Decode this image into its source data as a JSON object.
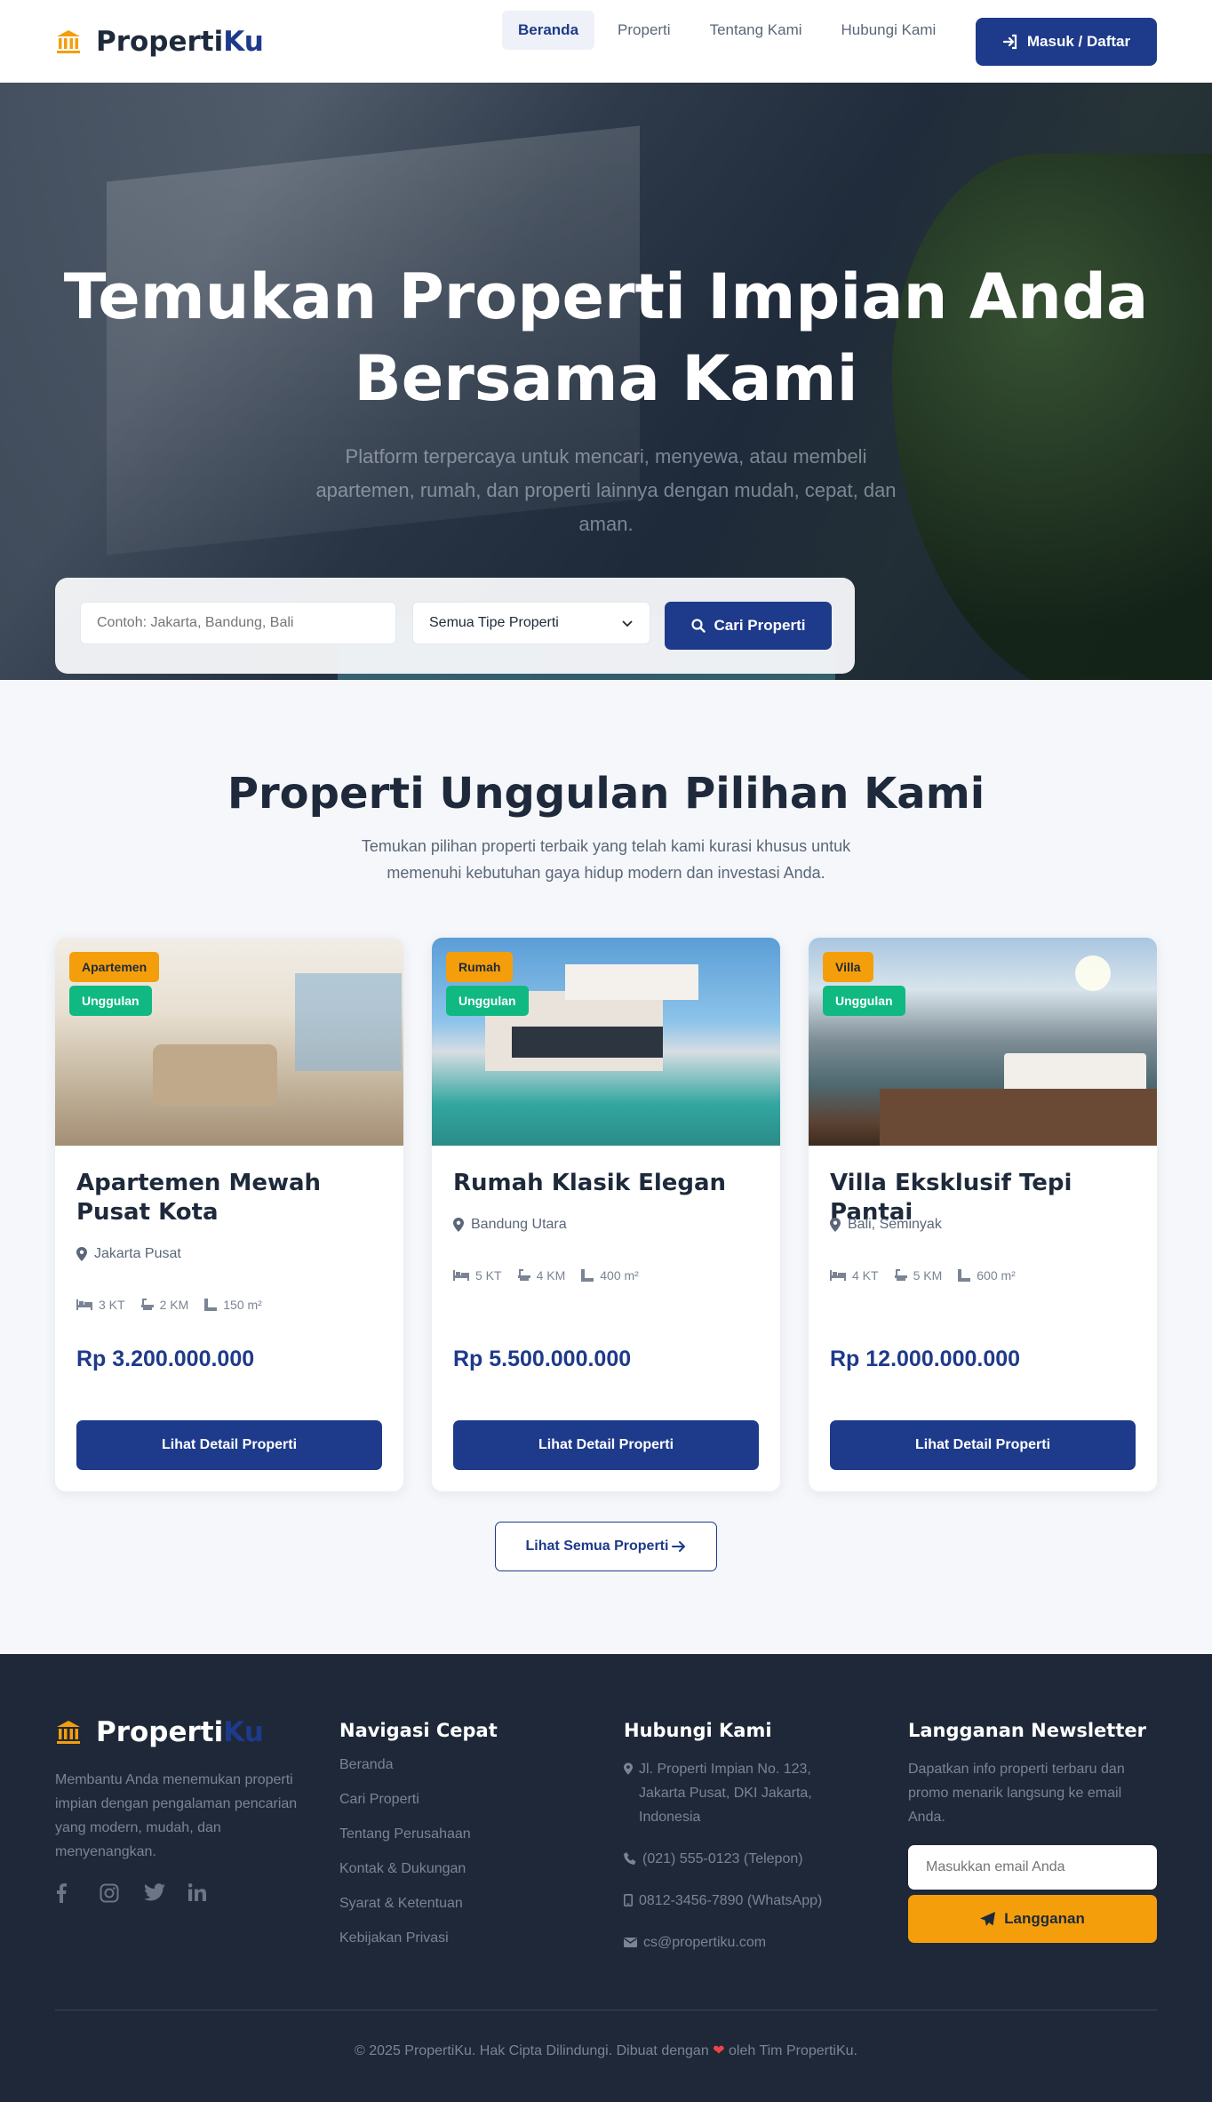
{
  "brand": {
    "name_main": "Properti",
    "name_accent": "Ku"
  },
  "nav": {
    "items": [
      {
        "label": "Beranda",
        "active": true
      },
      {
        "label": "Properti",
        "active": false
      },
      {
        "label": "Tentang Kami",
        "active": false
      },
      {
        "label": "Hubungi Kami",
        "active": false
      }
    ],
    "cta_label": "Masuk / Daftar"
  },
  "hero": {
    "title_line1": "Temukan Properti Impian Anda",
    "title_line2": "Bersama Kami",
    "subtitle": "Platform terpercaya untuk mencari, menyewa, atau membeli apartemen, rumah, dan properti lainnya dengan mudah, cepat, dan aman.",
    "search": {
      "location_placeholder": "Contoh: Jakarta, Bandung, Bali",
      "type_selected": "Semua Tipe Properti",
      "button_label": "Cari Properti"
    }
  },
  "featured": {
    "title": "Properti Unggulan Pilihan Kami",
    "subtitle": "Temukan pilihan properti terbaik yang telah kami kurasi khusus untuk memenuhi kebutuhan gaya hidup modern dan investasi Anda.",
    "cards": [
      {
        "type": "Apartemen",
        "badge": "Unggulan",
        "title": "Apartemen Mewah Pusat Kota",
        "location": "Jakarta Pusat",
        "beds": "3 KT",
        "baths": "2 KM",
        "area": "150 m²",
        "price": "Rp 3.200.000.000",
        "button": "Lihat Detail Properti"
      },
      {
        "type": "Rumah",
        "badge": "Unggulan",
        "title": "Rumah Klasik Elegan",
        "location": "Bandung Utara",
        "beds": "5 KT",
        "baths": "4 KM",
        "area": "400 m²",
        "price": "Rp 5.500.000.000",
        "button": "Lihat Detail Properti"
      },
      {
        "type": "Villa",
        "badge": "Unggulan",
        "title": "Villa Eksklusif Tepi Pantai",
        "location": "Bali, Seminyak",
        "beds": "4 KT",
        "baths": "5 KM",
        "area": "600 m²",
        "price": "Rp 12.000.000.000",
        "button": "Lihat Detail Properti"
      }
    ],
    "see_all_label": "Lihat Semua Properti"
  },
  "footer": {
    "description": "Membantu Anda menemukan properti impian dengan pengalaman pencarian yang modern, mudah, dan menyenangkan.",
    "social_icons": [
      "facebook-icon",
      "instagram-icon",
      "twitter-icon",
      "linkedin-icon"
    ],
    "nav_heading": "Navigasi Cepat",
    "nav_links": [
      "Beranda",
      "Cari Properti",
      "Tentang Perusahaan",
      "Kontak & Dukungan",
      "Syarat & Ketentuan",
      "Kebijakan Privasi"
    ],
    "contact_heading": "Hubungi Kami",
    "address": "Jl. Properti Impian No. 123, Jakarta Pusat, DKI Jakarta, Indonesia",
    "phone": "(021) 555-0123 (Telepon)",
    "whatsapp": "0812-3456-7890 (WhatsApp)",
    "email": "cs@propertiku.com",
    "newsletter_heading": "Langganan Newsletter",
    "newsletter_text": "Dapatkan info properti terbaru dan promo menarik langsung ke email Anda.",
    "newsletter_placeholder": "Masukkan email Anda",
    "newsletter_button": "Langganan",
    "copyright_before": "© 2025 PropertiKu. Hak Cipta Dilindungi. Dibuat dengan",
    "copyright_after": "oleh Tim PropertiKu."
  },
  "colors": {
    "primary": "#1e3a8a",
    "accent": "#f59e0b",
    "success": "#10b981",
    "footer_bg": "#1e2838"
  }
}
